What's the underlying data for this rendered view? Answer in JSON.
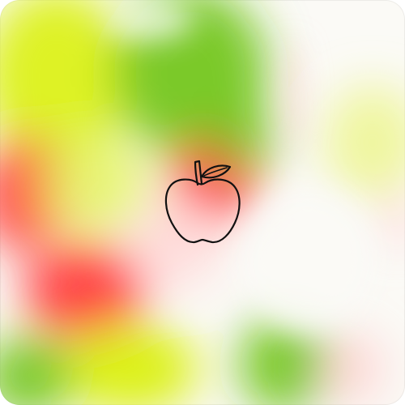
{
  "icon": {
    "name": "apple-icon",
    "stroke_color": "#111111"
  },
  "palette": {
    "background": "#fbfaf6",
    "green": "#74c61f",
    "lime": "#d8f000",
    "red": "#ff3b3b",
    "pink": "#ffd6d6"
  }
}
